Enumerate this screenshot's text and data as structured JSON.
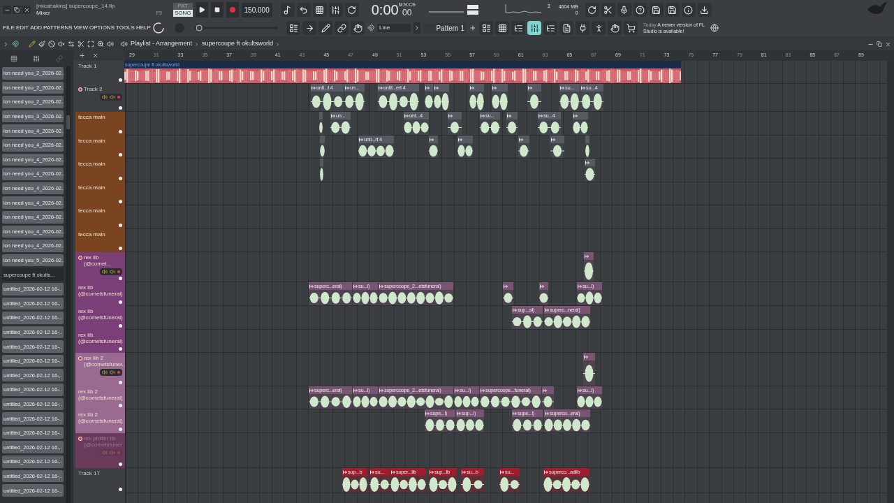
{
  "window": {
    "title": "[micahakins] supercoope_14.flp",
    "subtitle": "Mixer",
    "shortcut": "F9"
  },
  "transport": {
    "modes": [
      {
        "label": "PAT",
        "selected": false
      },
      {
        "label": "SONG",
        "selected": true
      }
    ],
    "tempo": "150.000",
    "time": "0:00",
    "time_cs": "00",
    "time_format": "M:S:CS"
  },
  "monitor": {
    "cpu": "3",
    "memory": "4604 MB",
    "polyphony": "0"
  },
  "menu": [
    "FILE",
    "EDIT",
    "ADD",
    "PATTERNS",
    "VIEW",
    "OPTIONS",
    "TOOLS",
    "HELP"
  ],
  "toolbar": {
    "snap": "Line",
    "pattern": "Pattern 1"
  },
  "song_position": {
    "level": 0.02
  },
  "view_buttons": [
    {
      "kind": "playlist",
      "selected": false
    },
    {
      "kind": "step",
      "selected": false
    },
    {
      "kind": "channels",
      "selected": false
    },
    {
      "kind": "mixer",
      "selected": true
    },
    {
      "kind": "browser",
      "selected": false
    },
    {
      "kind": "project",
      "selected": false
    },
    {
      "kind": "plugin",
      "selected": false
    },
    {
      "kind": "touch",
      "selected": false
    },
    {
      "kind": "drag",
      "selected": false
    },
    {
      "kind": "shop",
      "selected": false
    }
  ],
  "news": {
    "date": "Today",
    "message": "A newer version of FL Studio is available!"
  },
  "browser": {
    "items": [
      {
        "label": "ion need you_2_2026-02..",
        "selected": false
      },
      {
        "label": "ion need you_2_2026-02..",
        "selected": false
      },
      {
        "label": "ion need you_2_2026-02..",
        "selected": false
      },
      {
        "label": "ion need you_3_2026-02..",
        "selected": false
      },
      {
        "label": "ion need you_4_2026-02..",
        "selected": false
      },
      {
        "label": "ion need you_4_2026-02..",
        "selected": false
      },
      {
        "label": "ion need you_4_2026-02..",
        "selected": false
      },
      {
        "label": "ion need you_4_2026-02..",
        "selected": false
      },
      {
        "label": "ion need you_4_2026-02..",
        "selected": false
      },
      {
        "label": "ion need you_4_2026-02..",
        "selected": false
      },
      {
        "label": "ion need you_4_2026-02..",
        "selected": false
      },
      {
        "label": "ion need you_4_2026-02..",
        "selected": false
      },
      {
        "label": "ion need you_4_2026-02..",
        "selected": false
      },
      {
        "label": "ion need you_5_2026-02..",
        "selected": false
      },
      {
        "label": "supercoupe ft okults...",
        "selected": true
      },
      {
        "label": "untitled_2026-02-12 16-..",
        "selected": false
      },
      {
        "label": "untitled_2026-02-12 16-..",
        "selected": false
      },
      {
        "label": "untitled_2026-02-12 16-..",
        "selected": false
      },
      {
        "label": "untitled_2026-02-12 16-..",
        "selected": false
      },
      {
        "label": "untitled_2026-02-12 16-..",
        "selected": false
      },
      {
        "label": "untitled_2026-02-12 16-..",
        "selected": false
      },
      {
        "label": "untitled_2026-02-12 16-..",
        "selected": false
      },
      {
        "label": "untitled_2026-02-12 16-..",
        "selected": false
      },
      {
        "label": "untitled_2026-02-12 16-..",
        "selected": false
      },
      {
        "label": "untitled_2026-02-12 16-..",
        "selected": false
      },
      {
        "label": "untitled_2026-02-12 16-..",
        "selected": false
      },
      {
        "label": "untitled_2026-02-12 16-..",
        "selected": false
      },
      {
        "label": "untitled_2026-02-12 16-..",
        "selected": false
      },
      {
        "label": "untitled_2026-02-12 16-..",
        "selected": false
      },
      {
        "label": "untitled_2026-02-12 16-..",
        "selected": false
      }
    ]
  },
  "playlist": {
    "breadcrumbs": [
      "Playlist - Arrangement",
      "supercoupe ft okultsworld"
    ],
    "ruler": [
      "29",
      "31",
      "33",
      "35",
      "37",
      "39",
      "41",
      "43",
      "45",
      "47",
      "49",
      "51",
      "53",
      "55",
      "57",
      "59",
      "61",
      "63",
      "65",
      "67",
      "69",
      "71",
      "73",
      "75",
      "77",
      "79",
      "81",
      "83",
      "85",
      "87",
      "89"
    ],
    "tracks": [
      {
        "name": "Track 1",
        "kind": "track",
        "color": "#3b3f43",
        "disabled": false,
        "clips": [
          {
            "kind": "song",
            "label": "supercoupe ft okultsworld",
            "color": "#1c2b45"
          }
        ]
      },
      {
        "name": "Track 2",
        "kind": "group",
        "color": "#3b3f43",
        "disabled": false,
        "clips": [
          {
            "kind": "audio",
            "label": "unti...t 4",
            "color": "#565b63"
          },
          {
            "kind": "audio",
            "label": "un...",
            "color": "#565b63"
          },
          {
            "kind": "audio",
            "label": "untit...ert 4",
            "color": "#565b63"
          },
          {
            "kind": "audio",
            "color": "#565b63"
          },
          {
            "kind": "audio",
            "color": "#565b63"
          },
          {
            "kind": "audio",
            "color": "#565b63"
          },
          {
            "kind": "audio",
            "color": "#565b63"
          },
          {
            "kind": "audio",
            "color": "#565b63"
          },
          {
            "kind": "audio",
            "label": "su...",
            "color": "#565b63"
          },
          {
            "kind": "audio",
            "label": "su...4",
            "color": "#565b63"
          }
        ]
      },
      {
        "name": "tecca main",
        "kind": "track",
        "color": "#7a4420",
        "disabled": false,
        "clips": [
          {
            "kind": "audio",
            "color": "#565b63"
          },
          {
            "kind": "audio",
            "label": "un...",
            "color": "#565b63"
          },
          {
            "kind": "audio",
            "label": "unt...4",
            "color": "#565b63"
          },
          {
            "kind": "audio",
            "color": "#565b63"
          },
          {
            "kind": "audio",
            "label": "su...",
            "color": "#565b63"
          },
          {
            "kind": "audio",
            "color": "#565b63"
          },
          {
            "kind": "audio",
            "label": "su...4",
            "color": "#565b63"
          },
          {
            "kind": "audio",
            "color": "#565b63"
          }
        ]
      },
      {
        "name": "tecca main",
        "kind": "track",
        "color": "#7a4420",
        "disabled": false,
        "clips": [
          {
            "kind": "audio",
            "color": "#565b63"
          },
          {
            "kind": "audio",
            "label": "unti...rt 4",
            "color": "#565b63"
          },
          {
            "kind": "audio",
            "color": "#565b63"
          },
          {
            "kind": "audio",
            "color": "#565b63"
          },
          {
            "kind": "audio",
            "color": "#565b63"
          },
          {
            "kind": "audio",
            "color": "#565b63"
          },
          {
            "kind": "audio",
            "color": "#565b63"
          }
        ]
      },
      {
        "name": "tecca main",
        "kind": "track",
        "color": "#7a4420",
        "disabled": false,
        "clips": [
          {
            "kind": "audio",
            "color": "#565b63"
          },
          {
            "kind": "audio",
            "color": "#565b63"
          }
        ]
      },
      {
        "name": "tecca main",
        "kind": "track",
        "color": "#7a4420",
        "disabled": false
      },
      {
        "name": "tecca main",
        "kind": "track",
        "color": "#7a4420",
        "disabled": false
      },
      {
        "name": "tecca main",
        "kind": "track",
        "color": "#7a4420",
        "disabled": false
      },
      {
        "name": "rex lib (@comet...",
        "kind": "group",
        "color": "#7b3f78",
        "disabled": false,
        "clips": [
          {
            "kind": "audio",
            "color": "#7a5573"
          }
        ]
      },
      {
        "name": "rex lib (@cometsfuneral)",
        "kind": "track",
        "color": "#7b3f78",
        "disabled": false,
        "clips": [
          {
            "kind": "audio",
            "label": "superc...eral)",
            "color": "#7a5573"
          },
          {
            "kind": "audio",
            "label": "su...l)",
            "color": "#7a5573"
          },
          {
            "kind": "audio",
            "label": "supercoope_2...etsfuneral)",
            "color": "#7a5573"
          },
          {
            "kind": "audio",
            "color": "#7a5573"
          },
          {
            "kind": "audio",
            "color": "#7a5573"
          },
          {
            "kind": "audio",
            "label": "su...l)",
            "color": "#7a5573"
          }
        ]
      },
      {
        "name": "rex lib (@cometsfuneral)",
        "kind": "track",
        "color": "#7b3f78",
        "disabled": false,
        "clips": [
          {
            "kind": "audio",
            "label": "sup...al)",
            "color": "#7a5573"
          },
          {
            "kind": "audio",
            "label": "superc...neral)",
            "color": "#7a5573"
          }
        ]
      },
      {
        "name": "rex lib (@cometsfuneral)",
        "kind": "track",
        "color": "#7b3f78",
        "disabled": false
      },
      {
        "name": "rex lib 2 (@cometsfuner..",
        "kind": "group",
        "color": "#9a6a92",
        "disabled": false,
        "clips": [
          {
            "kind": "audio",
            "color": "#7a5573"
          }
        ]
      },
      {
        "name": "rex lib 2 (@cometsfuneral)",
        "kind": "track",
        "color": "#9a6a92",
        "disabled": false,
        "clips": [
          {
            "kind": "audio",
            "label": "superc...eral)",
            "color": "#7a5573"
          },
          {
            "kind": "audio",
            "label": "su...l)",
            "color": "#7a5573"
          },
          {
            "kind": "audio",
            "label": "supercoope_2...etsfuneral)",
            "color": "#7a5573"
          },
          {
            "kind": "audio",
            "label": "su...l)",
            "color": "#7a5573"
          },
          {
            "kind": "audio",
            "label": "supercoope...funeral)",
            "color": "#7a5573"
          },
          {
            "kind": "audio",
            "color": "#7a5573"
          },
          {
            "kind": "audio",
            "label": "su...l)",
            "color": "#7a5573"
          }
        ]
      },
      {
        "name": "rex lib 2 (@cometsfuneral)",
        "kind": "track",
        "color": "#9a6a92",
        "disabled": false,
        "clips": [
          {
            "kind": "audio",
            "label": "supe...l)",
            "color": "#7a5573"
          },
          {
            "kind": "audio",
            "label": "sup...l)",
            "color": "#7a5573"
          },
          {
            "kind": "audio",
            "label": "supe...l)",
            "color": "#7a5573"
          },
          {
            "kind": "audio",
            "label": "superco...eral)",
            "color": "#7a5573"
          }
        ]
      },
      {
        "name": "rex philter lib (@cometsfuner",
        "kind": "group",
        "color": "#6a3a5a",
        "disabled": true
      },
      {
        "name": "Track 17",
        "kind": "track",
        "color": "#3b3f43",
        "disabled": false,
        "clips": [
          {
            "kind": "audio",
            "label": "sup...b",
            "color": "#a01c2c"
          },
          {
            "kind": "audio",
            "label": "su...",
            "color": "#a01c2c"
          },
          {
            "kind": "audio",
            "label": "super...lib",
            "color": "#a01c2c"
          },
          {
            "kind": "audio",
            "label": "sup...lb",
            "color": "#a01c2c"
          },
          {
            "kind": "audio",
            "label": "su...b",
            "color": "#a01c2c"
          },
          {
            "kind": "audio",
            "label": "su...",
            "color": "#a01c2c"
          },
          {
            "kind": "audio",
            "label": "superco...adlib",
            "color": "#a01c2c"
          }
        ]
      }
    ]
  }
}
